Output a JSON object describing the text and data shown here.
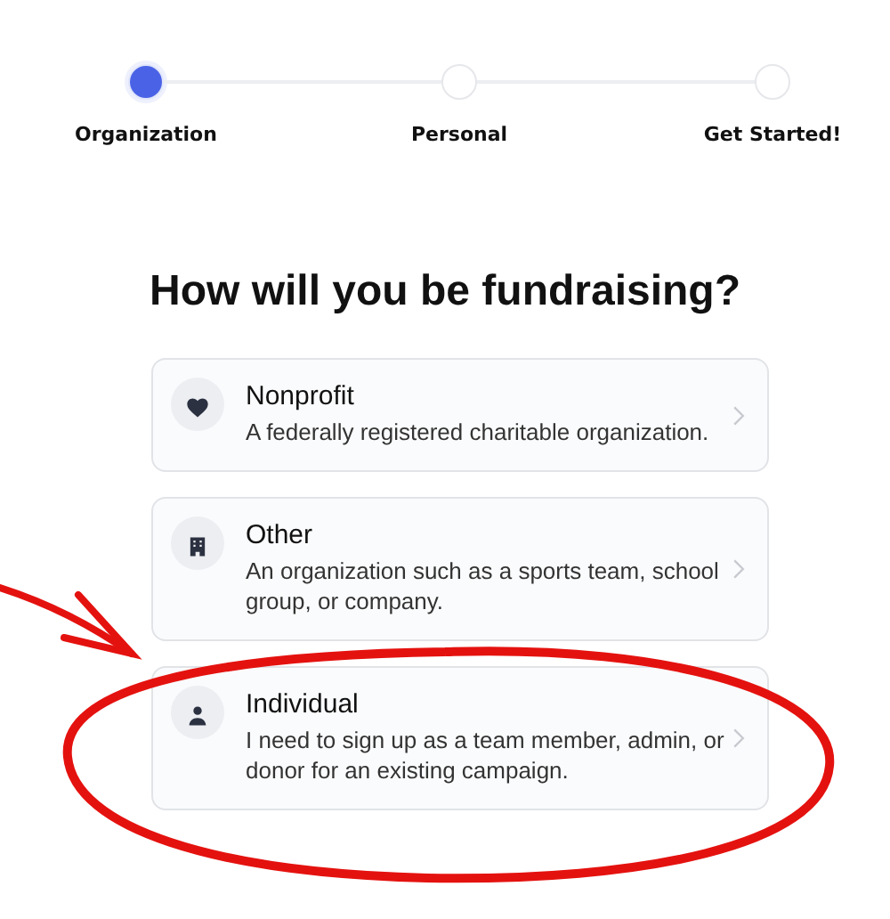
{
  "steps": [
    {
      "label": "Organization",
      "selected": true
    },
    {
      "label": "Personal",
      "selected": false
    },
    {
      "label": "Get Started!",
      "selected": false
    }
  ],
  "heading": "How will you be fundraising?",
  "options": [
    {
      "kind": "heart",
      "title": "Nonprofit",
      "description": "A federally registered charitable organization."
    },
    {
      "kind": "building",
      "title": "Other",
      "description": "An organization such as a sports team, school group, or company."
    },
    {
      "kind": "person",
      "title": "Individual",
      "description": "I need to sign up as a team member, admin, or donor for an existing campaign."
    }
  ]
}
